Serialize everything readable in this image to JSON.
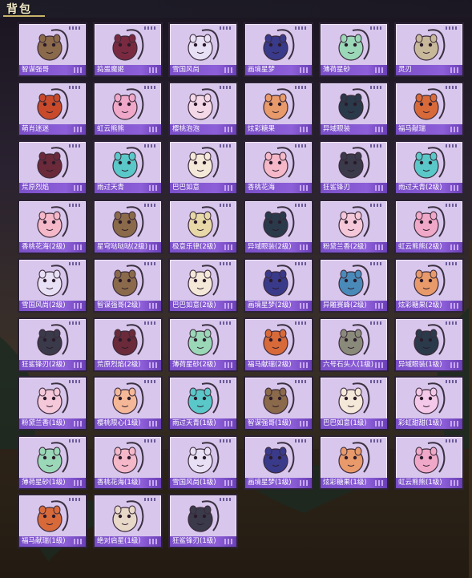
{
  "title": "背包",
  "items": [
    {
      "label": "智谋强哥",
      "icon": "bear-backpack-icon",
      "color": "#8a6a4a"
    },
    {
      "label": "捣蛋魔姬",
      "icon": "demon-backpack-icon",
      "color": "#7a2a40"
    },
    {
      "label": "雪国风尚",
      "icon": "snowman-backpack-icon",
      "color": "#e8e0f4"
    },
    {
      "label": "画境星梦",
      "icon": "frame-backpack-icon",
      "color": "#3a3a8a"
    },
    {
      "label": "薄荷星砂",
      "icon": "mint-backpack-icon",
      "color": "#9ad8b8"
    },
    {
      "label": "灵刃",
      "icon": "spiky-backpack-icon",
      "color": "#c8b89a"
    },
    {
      "label": "萌肖迷迷",
      "icon": "fox-backpack-icon",
      "color": "#c84a2a"
    },
    {
      "label": "虹云熊熊",
      "icon": "cloud-bear-backpack-icon",
      "color": "#f0a8c8"
    },
    {
      "label": "樱桃泡泡",
      "icon": "bow-backpack-icon",
      "color": "#f4d8e8"
    },
    {
      "label": "炫彩糖果",
      "icon": "candy-backpack-icon",
      "color": "#e89a6a"
    },
    {
      "label": "异域眼装",
      "icon": "tech-backpack-icon",
      "color": "#2a3a4a"
    },
    {
      "label": "福马献瑞",
      "icon": "horse-backpack-icon",
      "color": "#d86a3a"
    },
    {
      "label": "荒原烈焰",
      "icon": "flame-backpack-icon",
      "color": "#6a2a3a"
    },
    {
      "label": "雨过天青",
      "icon": "dragon-backpack-icon",
      "color": "#5ac8c8"
    },
    {
      "label": "巴巴如意",
      "icon": "bunny-backpack-icon",
      "color": "#f4e8d8"
    },
    {
      "label": "香桃花海",
      "icon": "peach-backpack-icon",
      "color": "#f4b8c8"
    },
    {
      "label": "狂鲨锋刃",
      "icon": "shark-backpack-icon",
      "color": "#3a3a4a"
    },
    {
      "label": "雨过天青(2级)",
      "icon": "dragon-backpack-icon",
      "color": "#5ac8c8"
    },
    {
      "label": "香桃花海(2级)",
      "icon": "peach-backpack-icon",
      "color": "#f4b8c8"
    },
    {
      "label": "星穹哒哒哒(2级)",
      "icon": "box-backpack-icon",
      "color": "#8a6a4a"
    },
    {
      "label": "极意乐律(2级)",
      "icon": "cup-backpack-icon",
      "color": "#e8d8a8"
    },
    {
      "label": "异域眼装(2级)",
      "icon": "tech-backpack-icon",
      "color": "#2a3a4a"
    },
    {
      "label": "粉黛兰香(2级)",
      "icon": "flower-backpack-icon",
      "color": "#f4c8d8"
    },
    {
      "label": "虹云熊熊(2级)",
      "icon": "cloud-bear-backpack-icon",
      "color": "#f0a8c8"
    },
    {
      "label": "雪国风尚(2级)",
      "icon": "snowman-backpack-icon",
      "color": "#e8e0f4"
    },
    {
      "label": "智谋强哥(2级)",
      "icon": "bear-backpack-icon",
      "color": "#8a6a4a"
    },
    {
      "label": "巴巴如意(2级)",
      "icon": "bunny-backpack-icon",
      "color": "#f4e8d8"
    },
    {
      "label": "画境星梦(2级)",
      "icon": "frame-backpack-icon",
      "color": "#3a3a8a"
    },
    {
      "label": "异雕赛蜂(2级)",
      "icon": "robot-backpack-icon",
      "color": "#4a8ab8"
    },
    {
      "label": "炫彩糖果(2级)",
      "icon": "candy-backpack-icon",
      "color": "#e89a6a"
    },
    {
      "label": "狂鲨锋刃(2级)",
      "icon": "shark-backpack-icon",
      "color": "#3a3a4a"
    },
    {
      "label": "荒原烈焰(2级)",
      "icon": "flame-backpack-icon",
      "color": "#6a2a3a"
    },
    {
      "label": "薄荷星砂(2级)",
      "icon": "mint-backpack-icon",
      "color": "#9ad8b8"
    },
    {
      "label": "福马献瑞(2级)",
      "icon": "horse-backpack-icon",
      "color": "#d86a3a"
    },
    {
      "label": "六号石头人(1级)",
      "icon": "golem-backpack-icon",
      "color": "#8a8a7a"
    },
    {
      "label": "异域眼装(1级)",
      "icon": "tech-backpack-icon",
      "color": "#2a3a4a"
    },
    {
      "label": "粉黛兰香(1级)",
      "icon": "flower-backpack-icon",
      "color": "#f4c8d8"
    },
    {
      "label": "樱桃限心(1级)",
      "icon": "heart-backpack-icon",
      "color": "#f4b898"
    },
    {
      "label": "雨过天青(1级)",
      "icon": "dragon-backpack-icon",
      "color": "#5ac8c8"
    },
    {
      "label": "智谋强哥(1级)",
      "icon": "bear-backpack-icon",
      "color": "#8a6a4a"
    },
    {
      "label": "巴巴如意(1级)",
      "icon": "bunny-backpack-icon",
      "color": "#f4e8d8"
    },
    {
      "label": "彩虹甜甜(1级)",
      "icon": "rainbow-backpack-icon",
      "color": "#f4c8e8"
    },
    {
      "label": "薄荷星砂(1级)",
      "icon": "mint-backpack-icon",
      "color": "#9ad8b8"
    },
    {
      "label": "香桃花海(1级)",
      "icon": "peach-backpack-icon",
      "color": "#f4b8c8"
    },
    {
      "label": "雪国风尚(1级)",
      "icon": "snowman-backpack-icon",
      "color": "#e8e0f4"
    },
    {
      "label": "画境星梦(1级)",
      "icon": "frame-backpack-icon",
      "color": "#3a3a8a"
    },
    {
      "label": "炫彩糖果(1级)",
      "icon": "candy-backpack-icon",
      "color": "#e89a6a"
    },
    {
      "label": "虹云熊熊(1级)",
      "icon": "cloud-bear-backpack-icon",
      "color": "#f0a8c8"
    },
    {
      "label": "福马献瑞(1级)",
      "icon": "horse-backpack-icon",
      "color": "#d86a3a"
    },
    {
      "label": "绝对启星(1级)",
      "icon": "cup-backpack-icon",
      "color": "#e8d8c8"
    },
    {
      "label": "狂鲨锋刃(1级)",
      "icon": "shark-backpack-icon",
      "color": "#3a3a4a"
    }
  ]
}
